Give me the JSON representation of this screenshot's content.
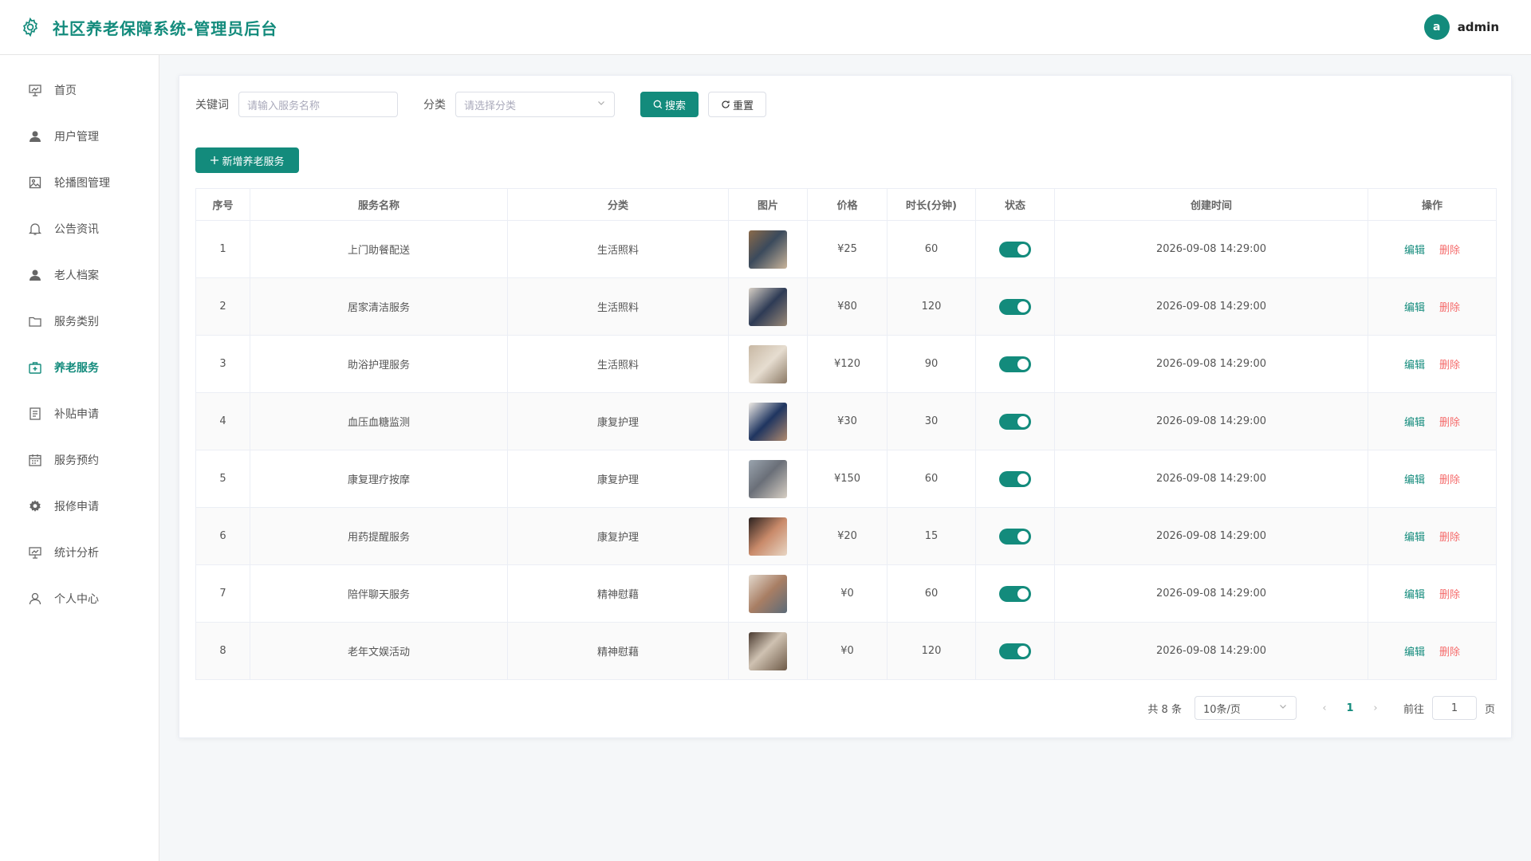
{
  "header": {
    "title": "社区养老保障系统-管理员后台",
    "avatar_letter": "a",
    "username": "admin",
    "accent": "#138b7c"
  },
  "sidebar": {
    "items": [
      {
        "label": "首页",
        "icon": "chart-board-icon",
        "active": false
      },
      {
        "label": "用户管理",
        "icon": "user-icon",
        "active": false
      },
      {
        "label": "轮播图管理",
        "icon": "picture-icon",
        "active": false
      },
      {
        "label": "公告资讯",
        "icon": "bell-icon",
        "active": false
      },
      {
        "label": "老人档案",
        "icon": "user-icon",
        "active": false
      },
      {
        "label": "服务类别",
        "icon": "folder-icon",
        "active": false
      },
      {
        "label": "养老服务",
        "icon": "first-aid-kit-icon",
        "active": true
      },
      {
        "label": "补贴申请",
        "icon": "document-icon",
        "active": false
      },
      {
        "label": "服务预约",
        "icon": "calendar-icon",
        "active": false
      },
      {
        "label": "报修申请",
        "icon": "gear-icon",
        "active": false
      },
      {
        "label": "统计分析",
        "icon": "chart-board-icon",
        "active": false
      },
      {
        "label": "个人中心",
        "icon": "user-outline-icon",
        "active": false
      }
    ]
  },
  "search": {
    "keyword_label": "关键词",
    "keyword_placeholder": "请输入服务名称",
    "category_label": "分类",
    "category_placeholder": "请选择分类",
    "search_button": "搜索",
    "reset_button": "重置"
  },
  "add_button": "新增养老服务",
  "table": {
    "columns": [
      "序号",
      "服务名称",
      "分类",
      "图片",
      "价格",
      "时长(分钟)",
      "状态",
      "创建时间",
      "操作"
    ],
    "edit_label": "编辑",
    "delete_label": "删除",
    "rows": [
      {
        "no": "1",
        "name": "上门助餐配送",
        "category": "生活照料",
        "price": "¥25",
        "duration": "60",
        "enabled": true,
        "created": "2026-09-08 14:29:00"
      },
      {
        "no": "2",
        "name": "居家清洁服务",
        "category": "生活照料",
        "price": "¥80",
        "duration": "120",
        "enabled": true,
        "created": "2026-09-08 14:29:00"
      },
      {
        "no": "3",
        "name": "助浴护理服务",
        "category": "生活照料",
        "price": "¥120",
        "duration": "90",
        "enabled": true,
        "created": "2026-09-08 14:29:00"
      },
      {
        "no": "4",
        "name": "血压血糖监测",
        "category": "康复护理",
        "price": "¥30",
        "duration": "30",
        "enabled": true,
        "created": "2026-09-08 14:29:00"
      },
      {
        "no": "5",
        "name": "康复理疗按摩",
        "category": "康复护理",
        "price": "¥150",
        "duration": "60",
        "enabled": true,
        "created": "2026-09-08 14:29:00"
      },
      {
        "no": "6",
        "name": "用药提醒服务",
        "category": "康复护理",
        "price": "¥20",
        "duration": "15",
        "enabled": true,
        "created": "2026-09-08 14:29:00"
      },
      {
        "no": "7",
        "name": "陪伴聊天服务",
        "category": "精神慰藉",
        "price": "¥0",
        "duration": "60",
        "enabled": true,
        "created": "2026-09-08 14:29:00"
      },
      {
        "no": "8",
        "name": "老年文娱活动",
        "category": "精神慰藉",
        "price": "¥0",
        "duration": "120",
        "enabled": true,
        "created": "2026-09-08 14:29:00"
      }
    ]
  },
  "pagination": {
    "total_text": "共 8 条",
    "page_size": "10条/页",
    "current_page": "1",
    "goto_label": "前往",
    "goto_value": "1",
    "page_suffix": "页"
  }
}
